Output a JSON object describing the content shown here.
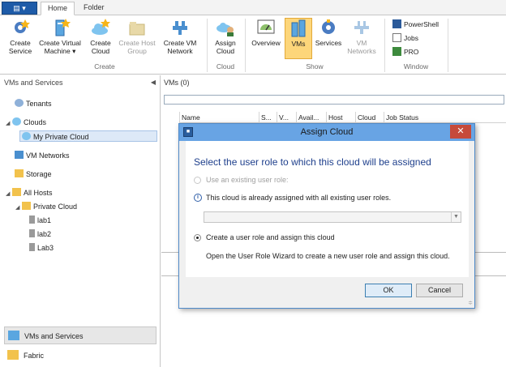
{
  "ribbon": {
    "tabs": [
      "Home",
      "Folder"
    ],
    "buttons": {
      "create_service": "Create Service",
      "create_vm": "Create Virtual Machine",
      "create_cloud": "Create Cloud",
      "create_host_group": "Create Host Group",
      "create_vm_network": "Create VM Network",
      "assign_cloud": "Assign Cloud",
      "overview": "Overview",
      "vms": "VMs",
      "services": "Services",
      "vm_networks": "VM Networks",
      "powershell": "PowerShell",
      "jobs": "Jobs",
      "pro": "PRO"
    },
    "groups": {
      "create": "Create",
      "cloud": "Cloud",
      "show": "Show",
      "window": "Window"
    }
  },
  "nav": {
    "header": "VMs and Services",
    "tree": {
      "tenants": "Tenants",
      "clouds": "Clouds",
      "my_private_cloud": "My Private Cloud",
      "vm_networks": "VM Networks",
      "storage": "Storage",
      "all_hosts": "All Hosts",
      "private_cloud": "Private Cloud",
      "lab1": "lab1",
      "lab2": "lab2",
      "lab3": "Lab3"
    },
    "workspaces": {
      "vms_services": "VMs and Services",
      "fabric": "Fabric"
    }
  },
  "main": {
    "header": "VMs (0)",
    "columns": [
      "Name",
      "S...",
      "V...",
      "Avail...",
      "Host",
      "Cloud",
      "Job Status"
    ]
  },
  "dialog": {
    "title": "Assign Cloud",
    "heading": "Select the user role to which this cloud will be assigned",
    "option_existing": "Use an existing user role:",
    "info": "This cloud is already assigned with all existing user roles.",
    "option_create": "Create a user role and assign this cloud",
    "create_description": "Open the User Role Wizard to create a new user role and assign this cloud.",
    "ok": "OK",
    "cancel": "Cancel"
  },
  "colors": {
    "accent": "#1e5ba8",
    "selected_tab": "#fdd67a",
    "dialog_title": "#68a4e4",
    "heading_blue": "#1e3f8c"
  }
}
